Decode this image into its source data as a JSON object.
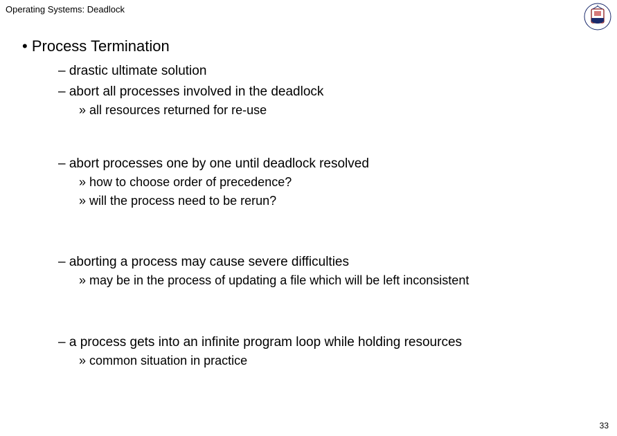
{
  "header": {
    "title": "Operating Systems: Deadlock"
  },
  "logo": {
    "alt": "University of Edinburgh crest"
  },
  "slide": {
    "bullet_dot": "•",
    "dash": "–",
    "dquote": "»",
    "main": "Process Termination",
    "items": [
      {
        "text": "drastic ultimate solution",
        "sub": []
      },
      {
        "text": "abort all processes involved in the deadlock",
        "sub": [
          "all resources returned for re-use"
        ]
      },
      {
        "text": "abort processes one by one until deadlock resolved",
        "sub": [
          "how to choose order of precedence?",
          "will the process need to be rerun?"
        ]
      },
      {
        "text": "aborting a process may cause severe difficulties",
        "sub": [
          "may be in the process of updating a file which will be left inconsistent"
        ]
      },
      {
        "text": "a process gets into an infinite program loop while holding resources",
        "sub": [
          "common situation in practice"
        ]
      }
    ]
  },
  "page_number": "33"
}
